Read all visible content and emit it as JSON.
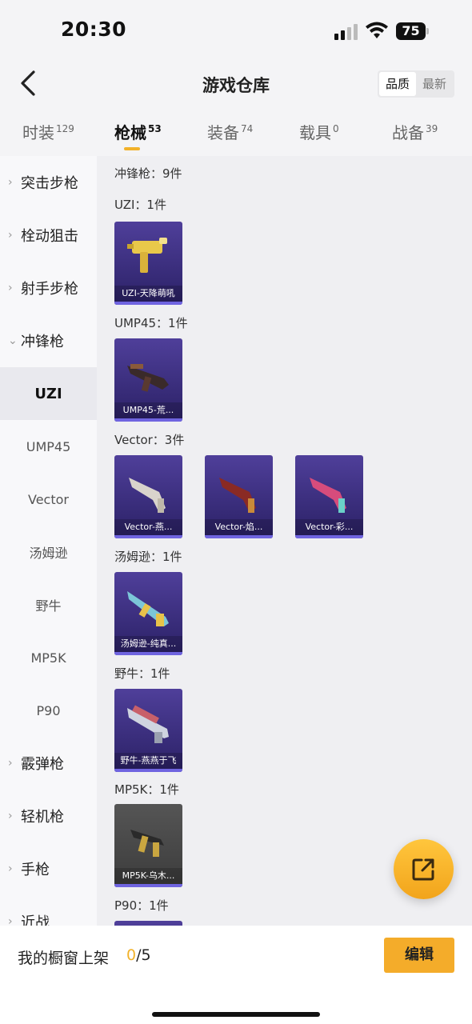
{
  "status_bar": {
    "time": "20:30",
    "battery": "75"
  },
  "header": {
    "title": "游戏仓库",
    "sort_options": [
      "品质",
      "最新"
    ]
  },
  "tabs": [
    {
      "label": "时装",
      "count": "129"
    },
    {
      "label": "枪械",
      "count": "53"
    },
    {
      "label": "装备",
      "count": "74"
    },
    {
      "label": "载具",
      "count": "0"
    },
    {
      "label": "战备",
      "count": "39"
    }
  ],
  "sidebar": {
    "items": [
      {
        "label": "突击步枪",
        "chevron": "›"
      },
      {
        "label": "栓动狙击",
        "chevron": "›"
      },
      {
        "label": "射手步枪",
        "chevron": "›"
      },
      {
        "label": "冲锋枪",
        "chevron": "⌄"
      },
      {
        "label": "UZI"
      },
      {
        "label": "UMP45"
      },
      {
        "label": "Vector"
      },
      {
        "label": "汤姆逊"
      },
      {
        "label": "野牛"
      },
      {
        "label": "MP5K"
      },
      {
        "label": "P90"
      },
      {
        "label": "霰弹枪",
        "chevron": "›"
      },
      {
        "label": "轻机枪",
        "chevron": "›"
      },
      {
        "label": "手枪",
        "chevron": "›"
      },
      {
        "label": "近战",
        "chevron": "›"
      }
    ]
  },
  "main": {
    "category_summary": "冲锋枪：9件",
    "groups": [
      {
        "title": "UZI：1件",
        "items": [
          "UZI-天降萌吼"
        ]
      },
      {
        "title": "UMP45：1件",
        "items": [
          "UMP45-荒..."
        ]
      },
      {
        "title": "Vector：3件",
        "items": [
          "Vector-燕...",
          "Vector-焰...",
          "Vector-彩..."
        ]
      },
      {
        "title": "汤姆逊：1件",
        "items": [
          "汤姆逊-纯真..."
        ]
      },
      {
        "title": "野牛：1件",
        "items": [
          "野牛-燕燕于飞"
        ]
      },
      {
        "title": "MP5K：1件",
        "items": [
          "MP5K-乌木..."
        ]
      },
      {
        "title": "P90：1件",
        "items": []
      }
    ]
  },
  "bottom_bar": {
    "shelf_label": "我的橱窗上架",
    "shelf_current": "0",
    "shelf_total": "/5",
    "edit_label": "编辑"
  },
  "colors": {
    "accent": "#f2b22a",
    "card_purple": "#3d2f86",
    "card_gray": "#4a4a4a"
  },
  "icons": {
    "back": "chevron-left-icon",
    "share": "share-external-icon",
    "wifi": "wifi-icon",
    "signal": "signal-icon",
    "battery": "battery-icon"
  }
}
